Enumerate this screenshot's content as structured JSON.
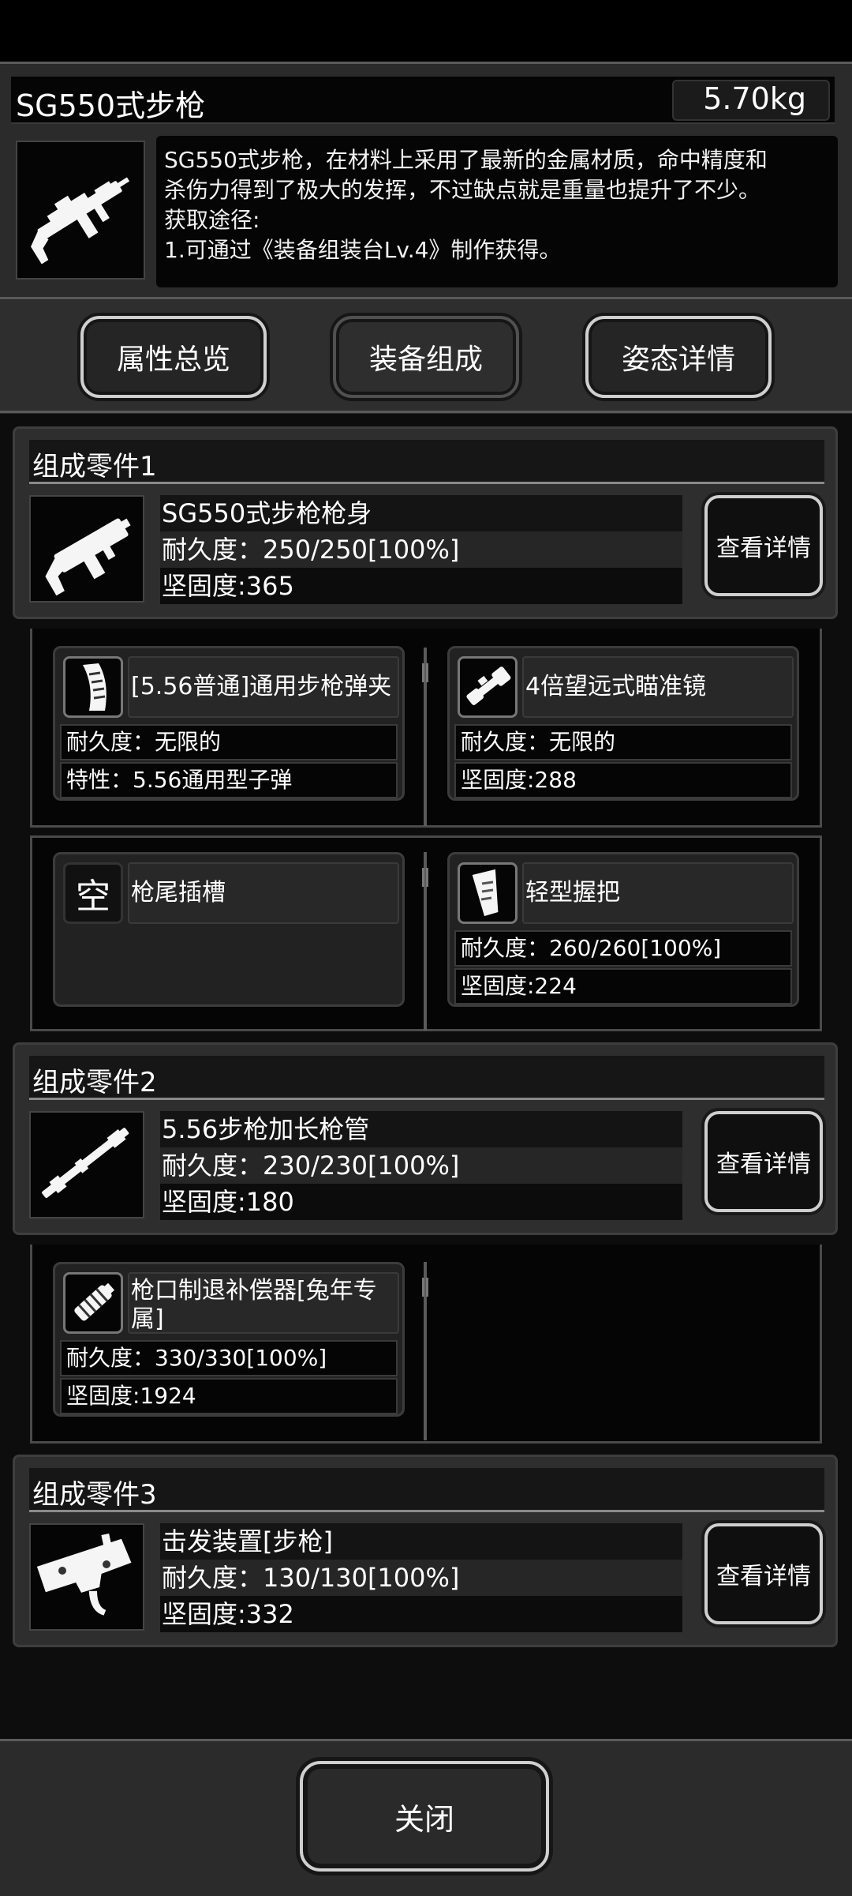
{
  "item": {
    "name": "SG550式步枪",
    "weight": "5.70kg",
    "icon": "assault-rifle-icon",
    "description": "SG550式步枪，在材料上采用了最新的金属材质，命中精度和\n杀伤力得到了极大的发挥，不过缺点就是重量也提升了不少。\n获取途径:\n1.可通过《装备组装台Lv.4》制作获得。"
  },
  "tabs": [
    {
      "label": "属性总览",
      "active": false
    },
    {
      "label": "装备组成",
      "active": true
    },
    {
      "label": "姿态详情",
      "active": false
    }
  ],
  "parts": [
    {
      "header": "组成零件1",
      "icon": "rifle-body-icon",
      "name": "SG550式步枪枪身",
      "durability": "耐久度：250/250[100%]",
      "toughness": "坚固度:365",
      "detail_label": "查看详情",
      "slots": [
        {
          "icon": "magazine-icon",
          "name": "[5.56普通]通用步枪弹夹",
          "line1": "耐久度：无限的",
          "line2": "特性：5.56通用型子弹"
        },
        {
          "icon": "scope-icon",
          "name": "4倍望远式瞄准镜",
          "line1": "耐久度：无限的",
          "line2": "坚固度:288"
        },
        {
          "icon_text": "空",
          "name": "枪尾插槽",
          "line1": "",
          "line2": ""
        },
        {
          "icon": "grip-icon",
          "name": "轻型握把",
          "line1": "耐久度：260/260[100%]",
          "line2": "坚固度:224"
        }
      ]
    },
    {
      "header": "组成零件2",
      "icon": "barrel-icon",
      "name": "5.56步枪加长枪管",
      "durability": "耐久度：230/230[100%]",
      "toughness": "坚固度:180",
      "detail_label": "查看详情",
      "slots": [
        {
          "icon": "muzzle-brake-icon",
          "name": "枪口制退补偿器[兔年专属]",
          "line1": "耐久度：330/330[100%]",
          "line2": "坚固度:1924"
        }
      ]
    },
    {
      "header": "组成零件3",
      "icon": "trigger-mechanism-icon",
      "name": "击发装置[步枪]",
      "durability": "耐久度：130/130[100%]",
      "toughness": "坚固度:332",
      "detail_label": "查看详情"
    }
  ],
  "close_label": "关闭"
}
